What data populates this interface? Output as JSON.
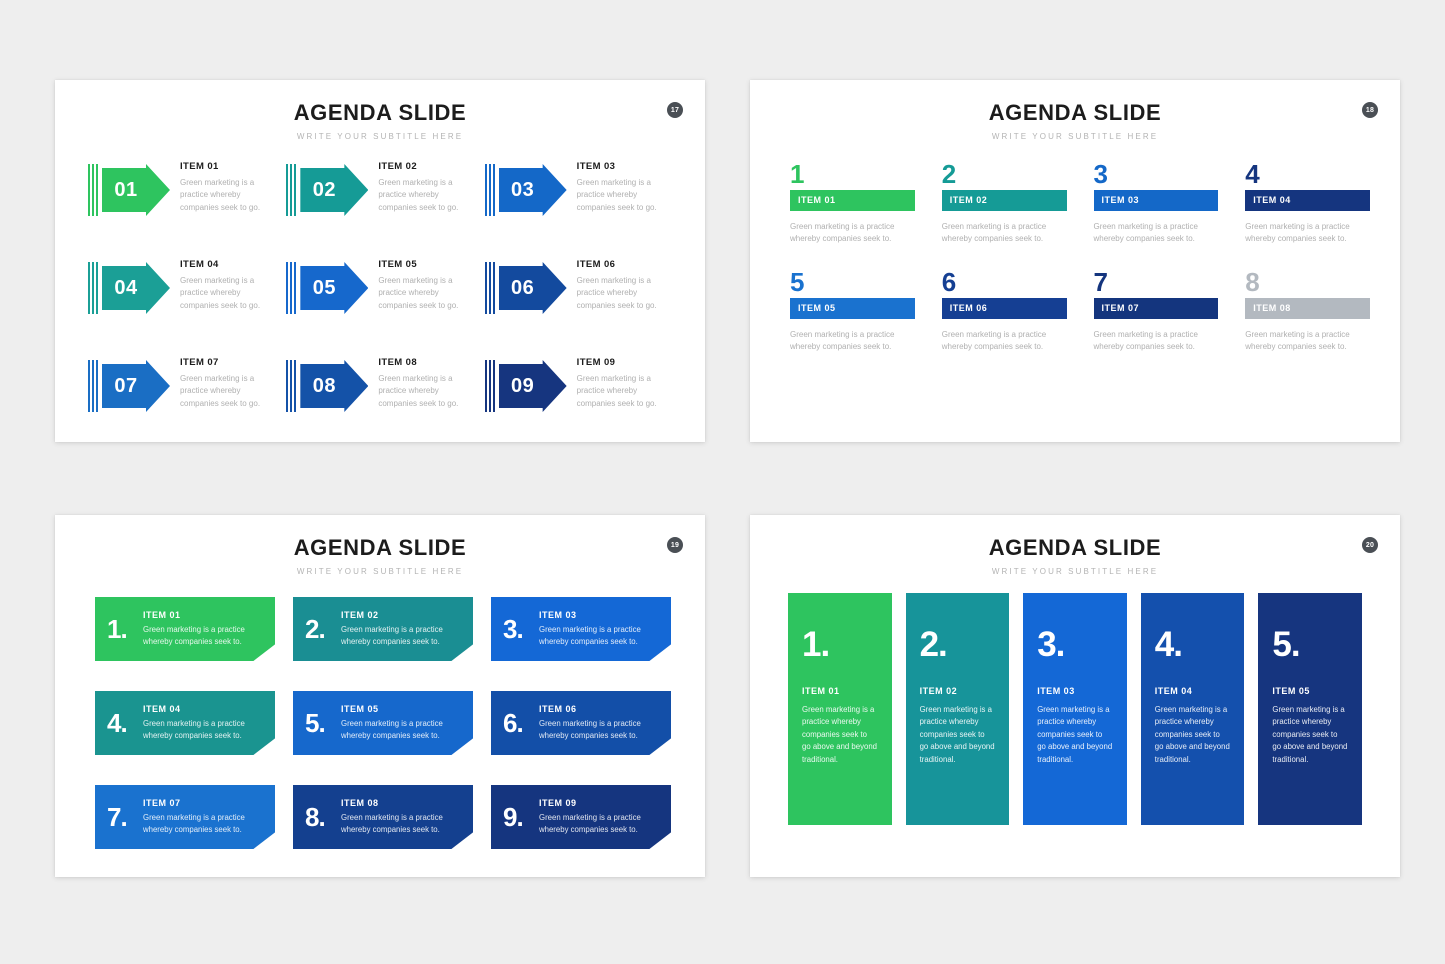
{
  "slides": [
    {
      "id": "slide-1",
      "title": "AGENDA SLIDE",
      "subtitle": "WRITE YOUR SUBTITLE HERE",
      "page_number": "17",
      "style": "arrows",
      "items": [
        {
          "number": "01",
          "title": "ITEM 01",
          "desc": "Green marketing is a practice whereby companies seek to go.",
          "color": "#2ec45f"
        },
        {
          "number": "02",
          "title": "ITEM 02",
          "desc": "Green marketing is a practice whereby companies seek to go.",
          "color": "#159b96"
        },
        {
          "number": "03",
          "title": "ITEM 03",
          "desc": "Green marketing is a practice whereby companies seek to go.",
          "color": "#1468c8"
        },
        {
          "number": "04",
          "title": "ITEM 04",
          "desc": "Green marketing is a practice whereby companies seek to go.",
          "color": "#1b9f96"
        },
        {
          "number": "05",
          "title": "ITEM 05",
          "desc": "Green marketing is a practice whereby companies seek to go.",
          "color": "#1668cc"
        },
        {
          "number": "06",
          "title": "ITEM 06",
          "desc": "Green marketing is a practice whereby companies seek to go.",
          "color": "#134a9e"
        },
        {
          "number": "07",
          "title": "ITEM 07",
          "desc": "Green marketing is a practice whereby companies seek to go.",
          "color": "#1a6ec4"
        },
        {
          "number": "08",
          "title": "ITEM 08",
          "desc": "Green marketing is a practice whereby companies seek to go.",
          "color": "#1452a8"
        },
        {
          "number": "09",
          "title": "ITEM 09",
          "desc": "Green marketing is a practice whereby companies seek to go.",
          "color": "#16357f"
        }
      ]
    },
    {
      "id": "slide-2",
      "title": "AGENDA SLIDE",
      "subtitle": "WRITE YOUR SUBTITLE HERE",
      "page_number": "18",
      "style": "bars",
      "items": [
        {
          "number": "1",
          "title": "ITEM 01",
          "desc": "Green marketing is a practice whereby companies seek to.",
          "color": "#2ec45f"
        },
        {
          "number": "2",
          "title": "ITEM 02",
          "desc": "Green marketing is a practice whereby companies seek to.",
          "color": "#159b96"
        },
        {
          "number": "3",
          "title": "ITEM 03",
          "desc": "Green marketing is a practice whereby companies seek to.",
          "color": "#1468c8"
        },
        {
          "number": "4",
          "title": "ITEM 04",
          "desc": "Green marketing is a practice whereby companies seek to.",
          "color": "#15357f"
        },
        {
          "number": "5",
          "title": "ITEM 05",
          "desc": "Green marketing is a practice whereby companies seek to.",
          "color": "#1a72cf"
        },
        {
          "number": "6",
          "title": "ITEM 06",
          "desc": "Green marketing is a practice whereby companies seek to.",
          "color": "#153f93"
        },
        {
          "number": "7",
          "title": "ITEM 07",
          "desc": "Green marketing is a practice whereby companies seek to.",
          "color": "#14357e"
        },
        {
          "number": "8",
          "title": "ITEM 08",
          "desc": "Green marketing is a practice whereby companies seek to.",
          "color": "#b3b9c0"
        }
      ]
    },
    {
      "id": "slide-3",
      "title": "AGENDA SLIDE",
      "subtitle": "WRITE YOUR SUBTITLE HERE",
      "page_number": "19",
      "style": "folded-cards",
      "items": [
        {
          "number": "1.",
          "title": "ITEM 01",
          "desc": "Green marketing is a practice whereby companies seek to.",
          "color": "#2ec45f"
        },
        {
          "number": "2.",
          "title": "ITEM 02",
          "desc": "Green marketing is a practice whereby companies seek to.",
          "color": "#1a8e93"
        },
        {
          "number": "3.",
          "title": "ITEM 03",
          "desc": "Green marketing is a practice whereby companies seek to.",
          "color": "#1468d6"
        },
        {
          "number": "4.",
          "title": "ITEM 04",
          "desc": "Green marketing is a practice whereby companies seek to.",
          "color": "#1a9490"
        },
        {
          "number": "5.",
          "title": "ITEM 05",
          "desc": "Green marketing is a practice whereby companies seek to.",
          "color": "#1668cc"
        },
        {
          "number": "6.",
          "title": "ITEM 06",
          "desc": "Green marketing is a practice whereby companies seek to.",
          "color": "#134fa8"
        },
        {
          "number": "7.",
          "title": "ITEM 07",
          "desc": "Green marketing is a practice whereby companies seek to.",
          "color": "#1a72cf"
        },
        {
          "number": "8.",
          "title": "ITEM 08",
          "desc": "Green marketing is a practice whereby companies seek to.",
          "color": "#14408f"
        },
        {
          "number": "9.",
          "title": "ITEM 09",
          "desc": "Green marketing is a practice whereby companies seek to.",
          "color": "#15357f"
        }
      ]
    },
    {
      "id": "slide-4",
      "title": "AGENDA SLIDE",
      "subtitle": "WRITE YOUR SUBTITLE HERE",
      "page_number": "20",
      "style": "tall-columns",
      "items": [
        {
          "number": "1.",
          "title": "ITEM 01",
          "desc": "Green marketing is a practice whereby companies seek to go above and beyond traditional.",
          "color": "#2ec45f"
        },
        {
          "number": "2.",
          "title": "ITEM 02",
          "desc": "Green marketing is a practice whereby companies seek to go above and beyond traditional.",
          "color": "#17949a"
        },
        {
          "number": "3.",
          "title": "ITEM 03",
          "desc": "Green marketing is a practice whereby companies seek to go above and beyond traditional.",
          "color": "#1468d6"
        },
        {
          "number": "4.",
          "title": "ITEM 04",
          "desc": "Green marketing is a practice whereby companies seek to go above and beyond traditional.",
          "color": "#1450ad"
        },
        {
          "number": "5.",
          "title": "ITEM 05",
          "desc": "Green marketing is a practice whereby companies seek to go above and beyond traditional.",
          "color": "#16357f"
        }
      ]
    }
  ]
}
